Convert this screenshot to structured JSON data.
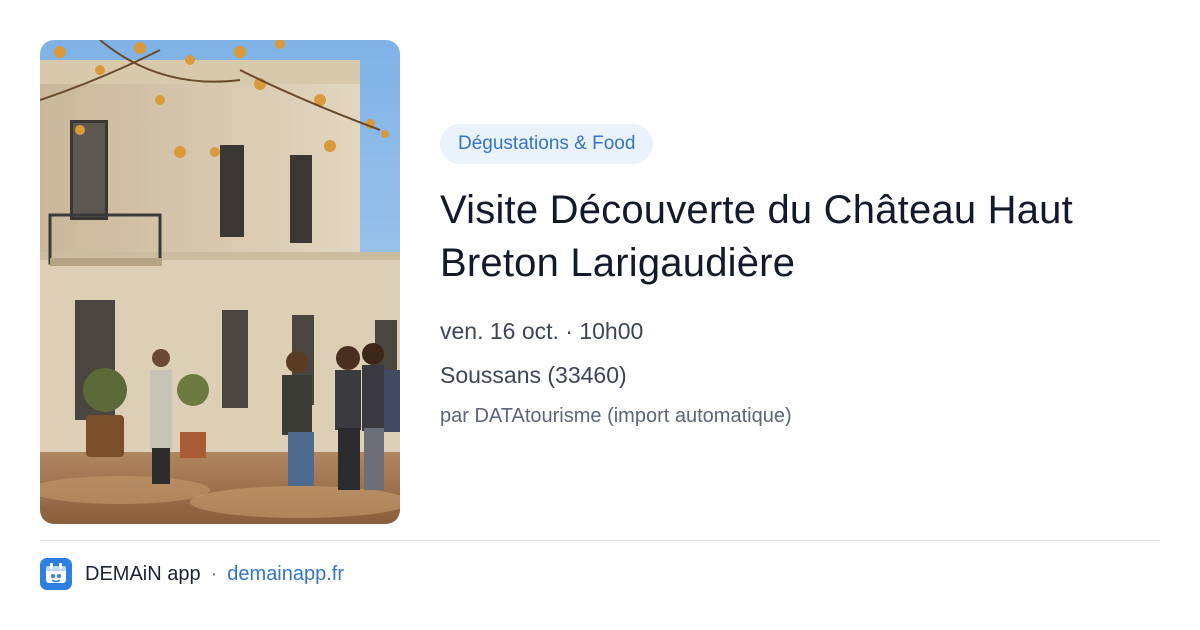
{
  "image": {
    "alt": "Façade du château avec visiteurs",
    "icon": "chateau-photo"
  },
  "event": {
    "category": "Dégustations & Food",
    "title": "Visite Découverte du Château Haut Breton Larigaudière",
    "date": "ven. 16 oct. · 10h00",
    "location": "Soussans (33460)",
    "source": "par DATAtourisme (import automatique)"
  },
  "footer": {
    "app_name": "DEMAiN app",
    "separator": "·",
    "link": "demainapp.fr",
    "logo_icon": "demain-app-logo-icon"
  },
  "colors": {
    "accent": "#3575c4",
    "pill_bg": "#eaf2fb",
    "logo_bg": "#2f7fe0"
  }
}
